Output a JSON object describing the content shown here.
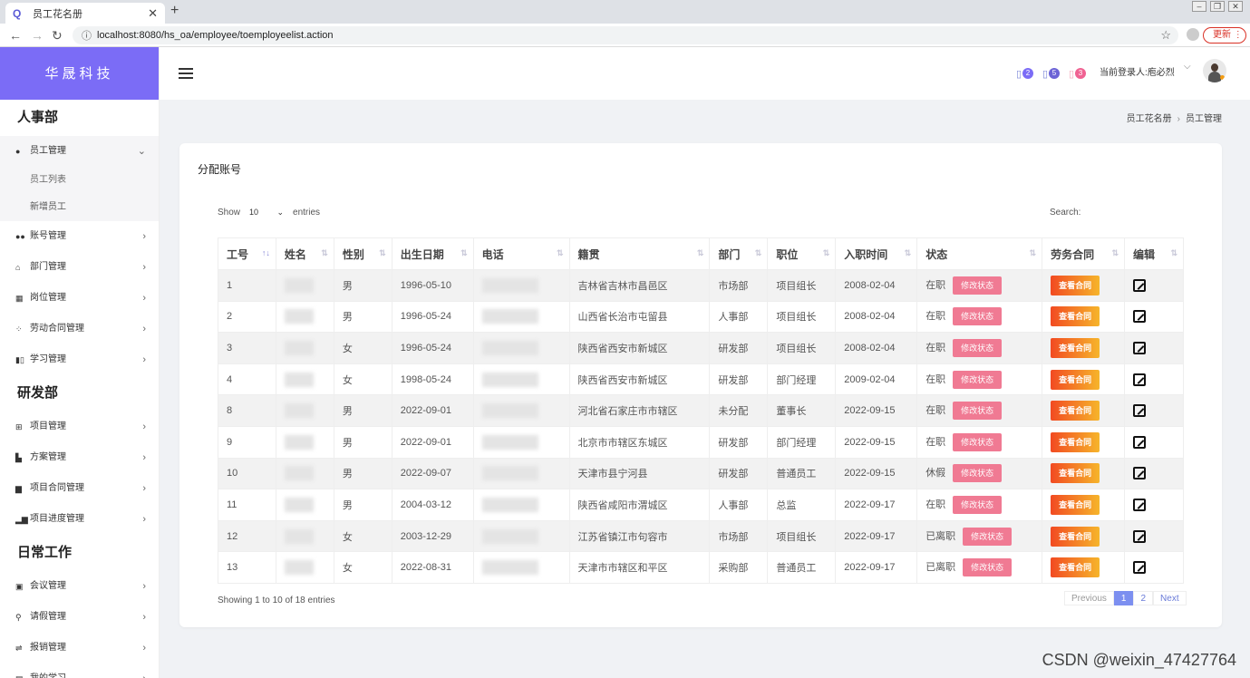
{
  "browser": {
    "tab_title": "员工花名册",
    "tab_favicon": "Q",
    "url": "localhost:8080/hs_oa/employee/toemployeelist.action",
    "update_label": "更新"
  },
  "sidebar": {
    "logo": "华晟科技",
    "sections": [
      {
        "title": "人事部"
      },
      {
        "title": "研发部"
      },
      {
        "title": "日常工作"
      }
    ],
    "hr_items": [
      {
        "label": "员工管理",
        "icon": "user-icon"
      },
      {
        "label": "账号管理",
        "icon": "users-icon"
      },
      {
        "label": "部门管理",
        "icon": "home-icon"
      },
      {
        "label": "岗位管理",
        "icon": "grid-icon"
      },
      {
        "label": "劳动合同管理",
        "icon": "dots-grid-icon"
      },
      {
        "label": "学习管理",
        "icon": "book-icon"
      }
    ],
    "hr_sub_items": [
      {
        "label": "员工列表"
      },
      {
        "label": "新增员工"
      }
    ],
    "rd_items": [
      {
        "label": "项目管理",
        "icon": "table-icon"
      },
      {
        "label": "方案管理",
        "icon": "file-icon"
      },
      {
        "label": "项目合同管理",
        "icon": "contract-icon"
      },
      {
        "label": "项目进度管理",
        "icon": "bar-chart-icon"
      }
    ],
    "daily_items": [
      {
        "label": "会议管理",
        "icon": "calendar-icon"
      },
      {
        "label": "请假管理",
        "icon": "bicycle-icon"
      },
      {
        "label": "报销管理",
        "icon": "money-icon"
      },
      {
        "label": "我的学习",
        "icon": "study-icon"
      }
    ]
  },
  "header": {
    "notifications": [
      {
        "count": "2",
        "color": "#7b6cf6"
      },
      {
        "count": "5",
        "color": "#6c63d6"
      },
      {
        "count": "3",
        "color": "#f06292"
      }
    ],
    "user_label": "当前登录人:庖必烈"
  },
  "breadcrumb": {
    "root": "员工花名册",
    "current": "员工管理"
  },
  "card": {
    "title": "分配账号",
    "show_label": "Show",
    "entries_value": "10",
    "entries_label": "entries",
    "search_label": "Search:",
    "info": "Showing 1 to 10 of 18 entries",
    "pager": {
      "previous": "Previous",
      "pages": [
        "1",
        "2"
      ],
      "next": "Next"
    }
  },
  "table": {
    "columns": [
      "工号",
      "姓名",
      "性别",
      "出生日期",
      "电话",
      "籍贯",
      "部门",
      "职位",
      "入职时间",
      "状态",
      "劳务合同",
      "编辑"
    ],
    "status_button": "修改状态",
    "contract_button": "查看合同",
    "rows": [
      {
        "id": "1",
        "gender": "男",
        "birth": "1996-05-10",
        "origin": "吉林省吉林市昌邑区",
        "dept": "市场部",
        "position": "项目组长",
        "hired": "2008-02-04",
        "status": "在职"
      },
      {
        "id": "2",
        "gender": "男",
        "birth": "1996-05-24",
        "origin": "山西省长治市屯留县",
        "dept": "人事部",
        "position": "项目组长",
        "hired": "2008-02-04",
        "status": "在职"
      },
      {
        "id": "3",
        "gender": "女",
        "birth": "1996-05-24",
        "origin": "陕西省西安市新城区",
        "dept": "研发部",
        "position": "项目组长",
        "hired": "2008-02-04",
        "status": "在职"
      },
      {
        "id": "4",
        "gender": "女",
        "birth": "1998-05-24",
        "origin": "陕西省西安市新城区",
        "dept": "研发部",
        "position": "部门经理",
        "hired": "2009-02-04",
        "status": "在职"
      },
      {
        "id": "8",
        "gender": "男",
        "birth": "2022-09-01",
        "origin": "河北省石家庄市市辖区",
        "dept": "未分配",
        "position": "董事长",
        "hired": "2022-09-15",
        "status": "在职"
      },
      {
        "id": "9",
        "gender": "男",
        "birth": "2022-09-01",
        "origin": "北京市市辖区东城区",
        "dept": "研发部",
        "position": "部门经理",
        "hired": "2022-09-15",
        "status": "在职"
      },
      {
        "id": "10",
        "gender": "男",
        "birth": "2022-09-07",
        "origin": "天津市县宁河县",
        "dept": "研发部",
        "position": "普通员工",
        "hired": "2022-09-15",
        "status": "休假"
      },
      {
        "id": "11",
        "gender": "男",
        "birth": "2004-03-12",
        "origin": "陕西省咸阳市渭城区",
        "dept": "人事部",
        "position": "总监",
        "hired": "2022-09-17",
        "status": "在职"
      },
      {
        "id": "12",
        "gender": "女",
        "birth": "2003-12-29",
        "origin": "江苏省镇江市句容市",
        "dept": "市场部",
        "position": "项目组长",
        "hired": "2022-09-17",
        "status": "已离职"
      },
      {
        "id": "13",
        "gender": "女",
        "birth": "2022-08-31",
        "origin": "天津市市辖区和平区",
        "dept": "采购部",
        "position": "普通员工",
        "hired": "2022-09-17",
        "status": "已离职"
      }
    ]
  },
  "watermark": "CSDN @weixin_47427764"
}
